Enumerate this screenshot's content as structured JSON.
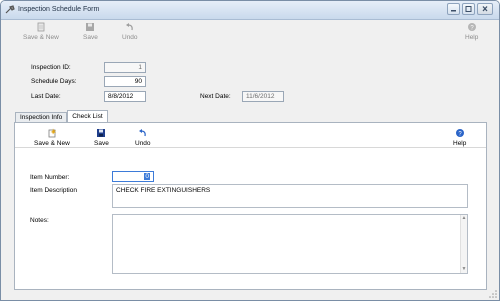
{
  "window": {
    "title": "Inspection Schedule Form",
    "controls": {
      "minimize": "▭",
      "maximize": "▭",
      "close": "✕"
    }
  },
  "top_toolbar": {
    "save_new": "Save & New",
    "save": "Save",
    "undo": "Undo",
    "help": "Help"
  },
  "form": {
    "inspection_id_label": "Inspection ID:",
    "inspection_id_value": "1",
    "schedule_days_label": "Schedule Days:",
    "schedule_days_value": "90",
    "last_date_label": "Last Date:",
    "last_date_value": "8/8/2012",
    "next_date_label": "Next Date:",
    "next_date_value": "11/6/2012"
  },
  "tabs": [
    {
      "label": "Inspection Info",
      "active": false
    },
    {
      "label": "Check List",
      "active": true
    }
  ],
  "checklist_toolbar": {
    "save_new": "Save & New",
    "save": "Save",
    "undo": "Undo",
    "help": "Help"
  },
  "checklist": {
    "item_number_label": "Item Number:",
    "item_number_value": "0",
    "item_description_label": "Item Description",
    "item_description_value": "CHECK FIRE EXTINGUISHERS",
    "notes_label": "Notes:",
    "notes_value": ""
  },
  "colors": {
    "save_icon": "#1f3e8c",
    "help_icon": "#2a64c8",
    "new_icon": "#e0a414"
  }
}
